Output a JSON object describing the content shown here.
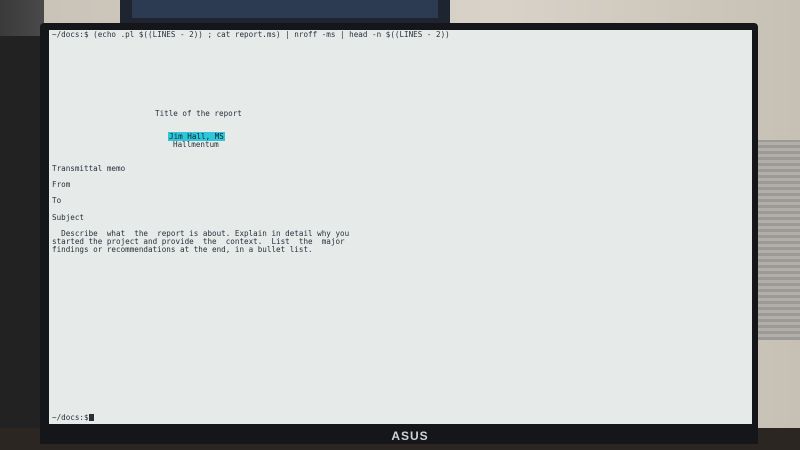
{
  "monitor": {
    "brand": "ASUS"
  },
  "terminal": {
    "command_line": "~/docs:$ (echo .pl $((LINES - 2)) ; cat report.ms) | nroff -ms | head -n $((LINES - 2))",
    "output": {
      "title": "Title of the report",
      "author": "Jim Hall, MS",
      "affiliation": "Hallmentum",
      "transmittal": "Transmittal memo",
      "from": "From",
      "to": "To",
      "subject": "Subject",
      "paragraph_lines": [
        "  Describe  what  the  report is about. Explain in detail why you",
        "started the project and provide  the  context.  List  the  major",
        "findings or recommendations at the end, in a bullet list."
      ]
    },
    "prompt": "~/docs:$"
  },
  "colors": {
    "screen_bg": "#e6ebea",
    "text": "#2a2f3a",
    "highlight": "#2fc6dc"
  }
}
